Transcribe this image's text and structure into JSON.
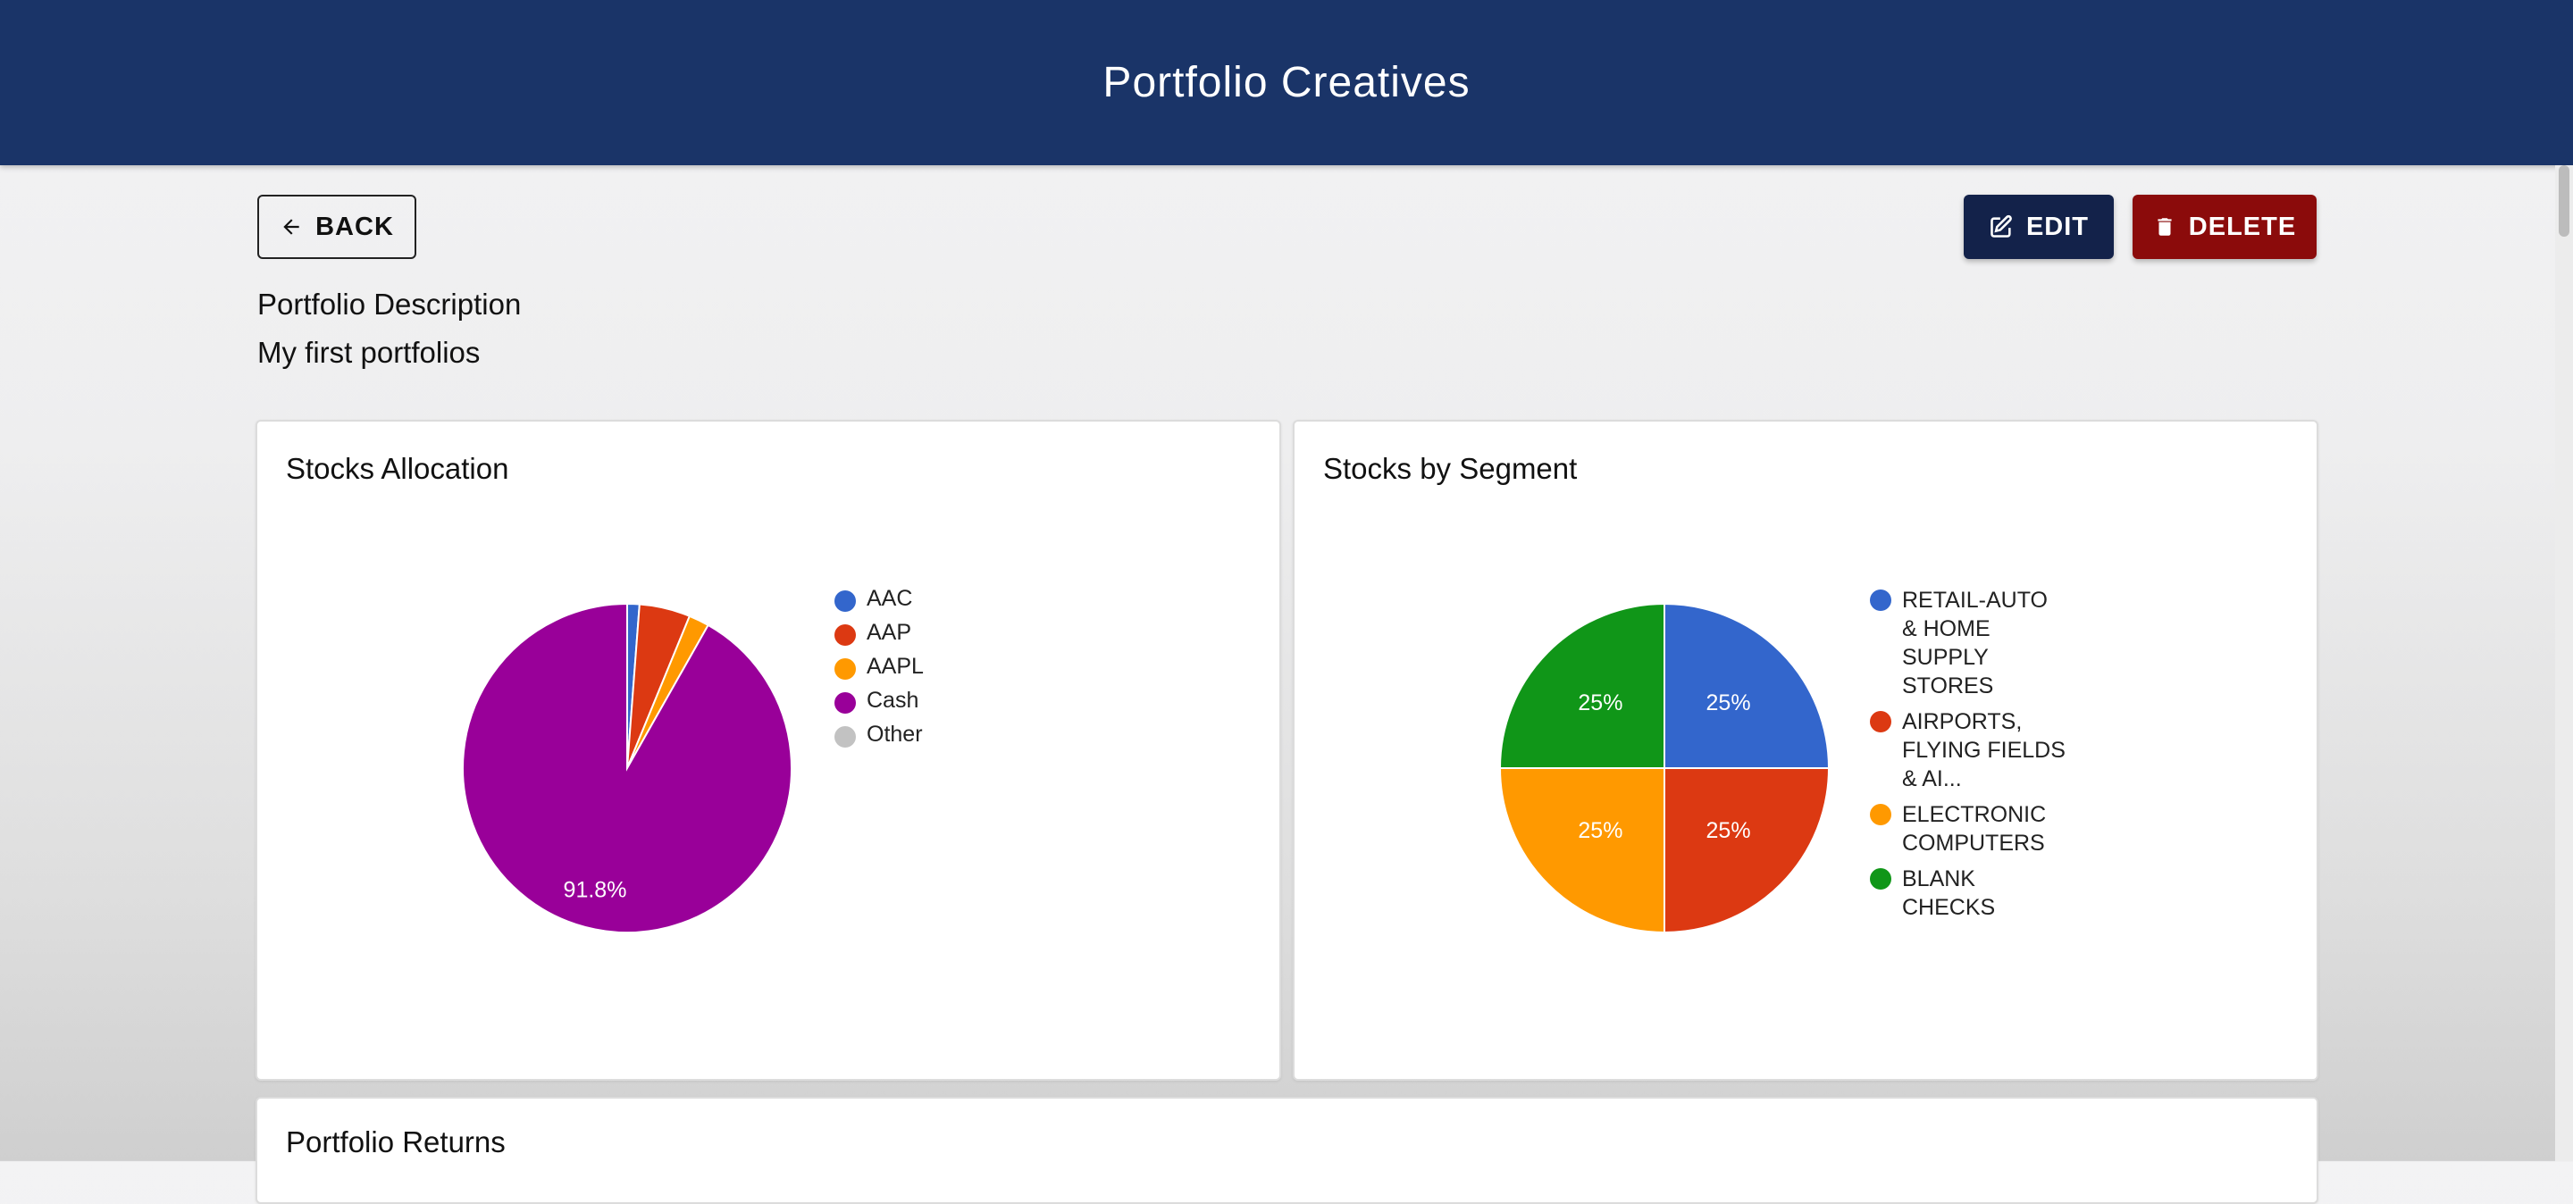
{
  "header": {
    "title": "Portfolio Creatives"
  },
  "toolbar": {
    "back_label": "BACK",
    "edit_label": "EDIT",
    "delete_label": "DELETE",
    "edit_color": "#13224a",
    "delete_color": "#8b0b0b"
  },
  "description": {
    "title": "Portfolio Description",
    "text": "My first portfolios"
  },
  "cards": {
    "allocation_title": "Stocks Allocation",
    "segment_title": "Stocks by Segment",
    "returns_title": "Portfolio Returns"
  },
  "chart_data": [
    {
      "type": "pie",
      "title": "Stocks Allocation",
      "legend_position": "right",
      "slices": [
        {
          "label": "AAC",
          "value": 1.2,
          "color": "#3366cc"
        },
        {
          "label": "AAP",
          "value": 5.0,
          "color": "#dc3912"
        },
        {
          "label": "AAPL",
          "value": 2.0,
          "color": "#ff9900"
        },
        {
          "label": "Cash",
          "value": 91.8,
          "color": "#990099"
        },
        {
          "label": "Other",
          "value": 0,
          "color": "#c2c2c2"
        }
      ],
      "visible_labels": [
        "91.8%"
      ]
    },
    {
      "type": "pie",
      "title": "Stocks by Segment",
      "legend_position": "right",
      "slices": [
        {
          "label": "RETAIL-AUTO & HOME SUPPLY STORES",
          "value": 25,
          "color": "#3366cc"
        },
        {
          "label": "AIRPORTS, FLYING FIELDS & AI...",
          "value": 25,
          "color": "#dc3912"
        },
        {
          "label": "ELECTRONIC COMPUTERS",
          "value": 25,
          "color": "#ff9900"
        },
        {
          "label": "BLANK CHECKS",
          "value": 25,
          "color": "#109618"
        }
      ],
      "visible_labels": [
        "25%",
        "25%",
        "25%",
        "25%"
      ]
    }
  ]
}
